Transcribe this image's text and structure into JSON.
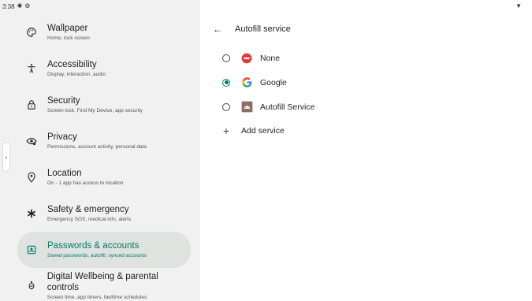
{
  "status_bar": {
    "time": "3:38",
    "icons": [
      "settings-icon",
      "settings-outline-icon",
      "wifi-icon"
    ]
  },
  "sidebar": {
    "items": [
      {
        "title": "Wallpaper",
        "subtitle": "Home, lock screen",
        "icon": "palette-icon"
      },
      {
        "title": "Accessibility",
        "subtitle": "Display, interaction, audio",
        "icon": "accessibility-icon"
      },
      {
        "title": "Security",
        "subtitle": "Screen lock, Find My Device, app security",
        "icon": "lock-icon"
      },
      {
        "title": "Privacy",
        "subtitle": "Permissions, account activity, personal data",
        "icon": "privacy-eye-icon"
      },
      {
        "title": "Location",
        "subtitle": "On - 1 app has access to location",
        "icon": "location-pin-icon"
      },
      {
        "title": "Safety & emergency",
        "subtitle": "Emergency SOS, medical info, alerts",
        "icon": "asterisk-icon"
      },
      {
        "title": "Passwords & accounts",
        "subtitle": "Saved passwords, autofill, synced accounts",
        "icon": "account-box-icon",
        "active": true
      },
      {
        "title": "Digital Wellbeing & parental controls",
        "subtitle": "Screen time, app timers, bedtime schedules",
        "icon": "wellbeing-icon"
      }
    ]
  },
  "detail": {
    "title": "Autofill service",
    "options": [
      {
        "label": "None",
        "icon": "no-entry-icon",
        "selected": false
      },
      {
        "label": "Google",
        "icon": "google-g-icon",
        "selected": true
      },
      {
        "label": "Autofill Service",
        "icon": "android-app-icon",
        "selected": false
      }
    ],
    "add_label": "Add service"
  },
  "colors": {
    "accent": "#00796b",
    "sidebar_bg": "#f1f1f1",
    "active_bg": "#dfe3df",
    "none_red": "#e53935",
    "android_brown": "#8d6e63"
  }
}
